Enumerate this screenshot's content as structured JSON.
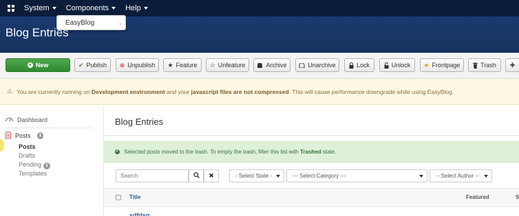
{
  "nav": {
    "items": [
      {
        "label": "System"
      },
      {
        "label": "Components"
      },
      {
        "label": "Help"
      }
    ],
    "dropdown": {
      "item": "EasyBlog"
    }
  },
  "header": {
    "title": "Blog Entries"
  },
  "toolbar": {
    "new": "New",
    "publish": "Publish",
    "unpublish": "Unpublish",
    "feature": "Feature",
    "unfeature": "Unfeature",
    "archive": "Archive",
    "unarchive": "Unarchive",
    "lock": "Lock",
    "unlock": "Unlock",
    "frontpage": "Frontpage",
    "trash": "Trash"
  },
  "warning": {
    "part1": "You are currently running on ",
    "env": "Development environment",
    "part2": " and your ",
    "js": "javascript files are not compressed",
    "part3": ". This will cause performance downgrade while using EasyBlog."
  },
  "sidebar": {
    "dashboard": "Dashboard",
    "posts": "Posts",
    "posts_badge": "1",
    "sub": {
      "posts": "Posts",
      "drafts": "Drafts",
      "pending": "Pending",
      "pending_badge": "1",
      "templates": "Templates"
    }
  },
  "main": {
    "title": "Blog Entries",
    "success": {
      "part1": "Selected posts moved to the trash. To empty the trash, filter this list with ",
      "bold": "Trashed",
      "part2": " state."
    },
    "search_placeholder": "Search",
    "filters": {
      "state": "- Select State -",
      "category": "--- Select Category ---",
      "author": "-- Select Author --"
    },
    "table": {
      "col_title": "Title",
      "col_featured": "Featured",
      "col_state": "S",
      "rows": [
        "sdfdsg"
      ]
    }
  }
}
